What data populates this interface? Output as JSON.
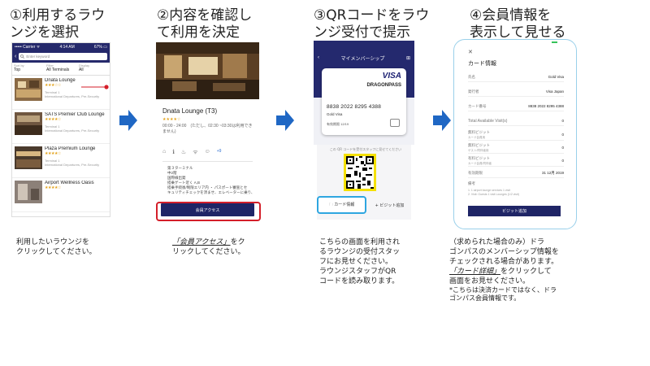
{
  "steps": [
    {
      "title_l1": "①利用するラウ",
      "title_l2": "ンジを選択",
      "desc_l1": "利用したいラウンジを",
      "desc_l2": "クリックしてください。"
    },
    {
      "title_l1": "②内容を確認し",
      "title_l2": "て利用を決定",
      "desc_u": "「会員アクセス」",
      "desc_l1b": "をク",
      "desc_l2": "リックしてください。"
    },
    {
      "title_l1": "③QRコードをラウ",
      "title_l2": "ンジ受付で提示",
      "desc_l1": "こちらの画面を利用され",
      "desc_l2": "るラウンジの受付スタッ",
      "desc_l3": "フにお見せください。",
      "desc_l4": "ラウンジスタッフがQR",
      "desc_l5": "コードを読み取ります。"
    },
    {
      "title_l1": "④会員情報を",
      "title_l2": "表示して見せる",
      "desc_l1": "（求められた場合のみ）ドラ",
      "desc_l2": "ゴンパスのメンバーシップ情報を",
      "desc_l3": "チェックされる場合があります。",
      "desc_u": "「カード詳細」",
      "desc_l4b": "をクリックして",
      "desc_l5": "画面をお見せください。",
      "desc_n1": "*こちらは決済カードではなく、ドラ",
      "desc_n2": "ゴンパス会員情報です。"
    }
  ],
  "phone1": {
    "status_left": "••••• Carrier ᯤ",
    "status_time": "4:14 AM",
    "status_right": "67% ▭",
    "back": "‹",
    "search_placeholder": "Enter keyword",
    "filters": [
      {
        "key": "Sort by",
        "value": "Top"
      },
      {
        "key": "Filter",
        "value": "All Terminals"
      },
      {
        "key": "Display",
        "value": "All"
      }
    ],
    "lounges": [
      {
        "name": "Dnata Lounge",
        "stars": "★★★☆☆",
        "terminal": "Terminal 1",
        "sub": "International Departures, Pre-Security"
      },
      {
        "name": "SATS Premier Club Lounge",
        "stars": "★★★★☆",
        "terminal": "Terminal 1",
        "sub": "International Departures, Pre-Security"
      },
      {
        "name": "Plaza Premium Lounge",
        "stars": "★★★★☆",
        "terminal": "Terminal 1",
        "sub": "International Departures, Pre-Security"
      },
      {
        "name": "Airport Wellness Oasis",
        "stars": "★★★★☆",
        "terminal": "",
        "sub": ""
      }
    ]
  },
  "phone2": {
    "lounge_name": "Dnata Lounge (T3)",
    "stars": "★★★★☆",
    "hours": "00:00 - 24:00　(ただし、02:30 ~03:30は利用できません)",
    "amenity_icons": [
      "⌂",
      "ℹ",
      "♨",
      "ᯤ",
      "☺",
      "+9"
    ],
    "detail_lines": [
      "第３ターミナル",
      "中2階",
      "国際線出発",
      "搭乗ゲート近く A,B",
      "搭乗手続後/制限エリア内 ・ パスポート審査とセ",
      "キュリティチェックを済ませ、エレベーターに乗り、"
    ],
    "button_label": "会員アクセス"
  },
  "phone3": {
    "header_title": "マイメンバーシップ",
    "back": "‹",
    "plus": "⊞",
    "card_brand": "VISA",
    "card_program": "DRAGONPASS",
    "card_number": "8838 2022 8295 4388",
    "card_tier": "Gold Visa",
    "card_expiry": "有効期限 12/19",
    "qr_note": "この QR コードを受付スタッフに見せてください",
    "btn_card_info": "🗀 カード情報",
    "btn_add_visit": "+ ビジット追加"
  },
  "phone4": {
    "close": "✕",
    "title": "カード情報",
    "rows": [
      {
        "label": "氏名",
        "value": "Gold Visa"
      },
      {
        "label": "発行者",
        "value": "Visa Japan"
      },
      {
        "label": "カード番号",
        "value": "8838 2022 8295 4388"
      },
      {
        "label": "Total Available Visit(s)",
        "value": "0"
      }
    ],
    "sub_rows": [
      {
        "label": "無料ビジット",
        "note": "カード会員用",
        "value": "0"
      },
      {
        "label": "無料ビジット",
        "note": "ゲスト/同伴者用",
        "value": "0"
      },
      {
        "label": "有料ビジット",
        "note": "カード会員/同伴者",
        "value": "0"
      }
    ],
    "expiry_label": "有効期限",
    "expiry_value": "31 12月 2019",
    "remarks_label": "備考",
    "remarks_lines": [
      "1. 1 airport lounge services 1 visit",
      "2. Visit: Guests 1 visit Lounges (1/2 visit)"
    ],
    "button_label": "ビジット追加"
  },
  "colors": {
    "navy": "#1f2566",
    "arrow": "#1f67c4",
    "red_highlight": "#d41f2a",
    "blue_highlight": "#2ea6e0",
    "yellow_highlight": "#f4e000"
  }
}
